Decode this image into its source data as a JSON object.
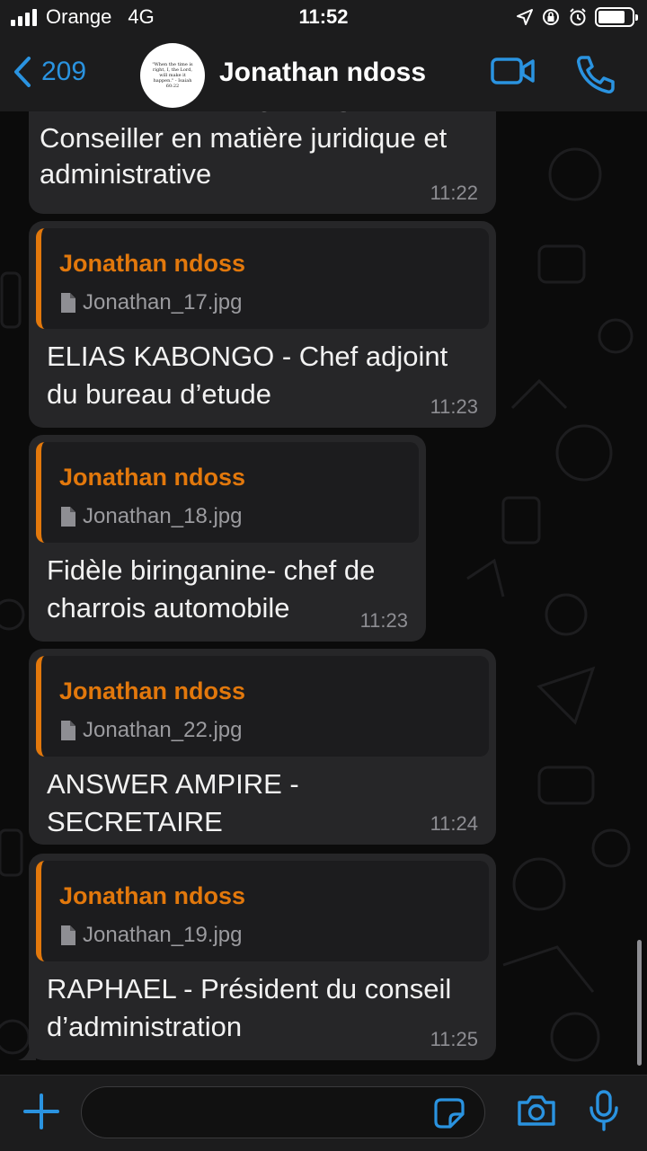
{
  "status_bar": {
    "carrier": "Orange",
    "network": "4G",
    "time": "11:52"
  },
  "header": {
    "back_count": "209",
    "contact_name": "Jonathan ndoss",
    "avatar_text": "\"When the time is right, I, the Lord, will make it happen.\" - Isaiah 60:22"
  },
  "messages": {
    "partial": {
      "line0": "Mr ALEXANDRE SHANGA",
      "text": "Conseiller en matière juridique et administrative",
      "time": "11:22"
    },
    "m1": {
      "reply_sender": "Jonathan ndoss",
      "reply_file": "Jonathan_17.jpg",
      "text": "ELIAS KABONGO - Chef adjoint du bureau d’etude",
      "time": "11:23"
    },
    "m2": {
      "reply_sender": "Jonathan ndoss",
      "reply_file": "Jonathan_18.jpg",
      "text": "Fidèle biringanine- chef de charrois automobile",
      "time": "11:23"
    },
    "m3": {
      "reply_sender": "Jonathan ndoss",
      "reply_file": "Jonathan_22.jpg",
      "text": "ANSWER AMPIRE - SECRETAIRE",
      "time": "11:24"
    },
    "m4": {
      "reply_sender": "Jonathan ndoss",
      "reply_file": "Jonathan_19.jpg",
      "text": "RAPHAEL - Président du conseil d’administration",
      "time": "11:25"
    }
  },
  "colors": {
    "accent": "#2a93e0",
    "reply_name": "#e2780c",
    "bubble": "#262628",
    "background": "#0b0b0b"
  }
}
